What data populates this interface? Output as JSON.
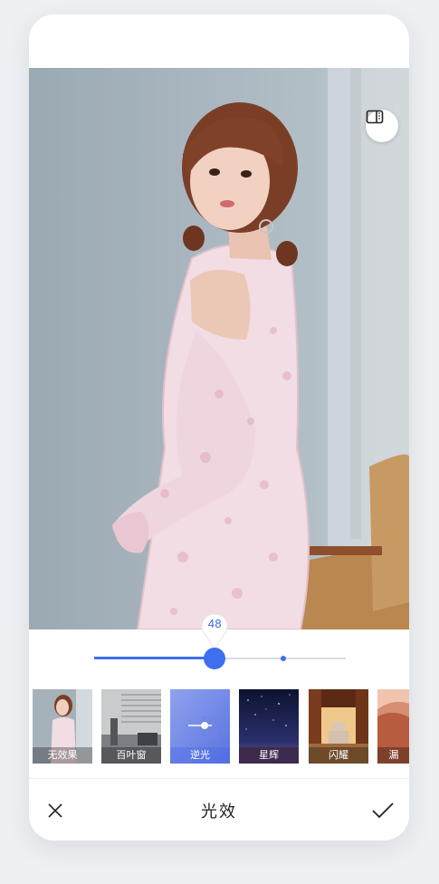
{
  "app": {
    "accent_color": "#3f6ef0"
  },
  "photo": {
    "subject": "woman-in-pink-dress"
  },
  "compare_button": {
    "icon": "compare-icon"
  },
  "intensity": {
    "value": "48",
    "level_percent": 48,
    "default_percent": 75
  },
  "filters": [
    {
      "label": "无效果",
      "icon": "thumbnail",
      "selected": false
    },
    {
      "label": "百叶窗",
      "icon": "thumbnail",
      "selected": false
    },
    {
      "label": "逆光",
      "icon": "slider-icon",
      "selected": true
    },
    {
      "label": "星辉",
      "icon": "thumbnail",
      "selected": false
    },
    {
      "label": "闪耀",
      "icon": "thumbnail",
      "selected": false
    },
    {
      "label": "漏",
      "icon": "thumbnail",
      "selected": false
    }
  ],
  "bottom_bar": {
    "title": "光效",
    "cancel_icon": "close-icon",
    "confirm_icon": "check-icon"
  }
}
